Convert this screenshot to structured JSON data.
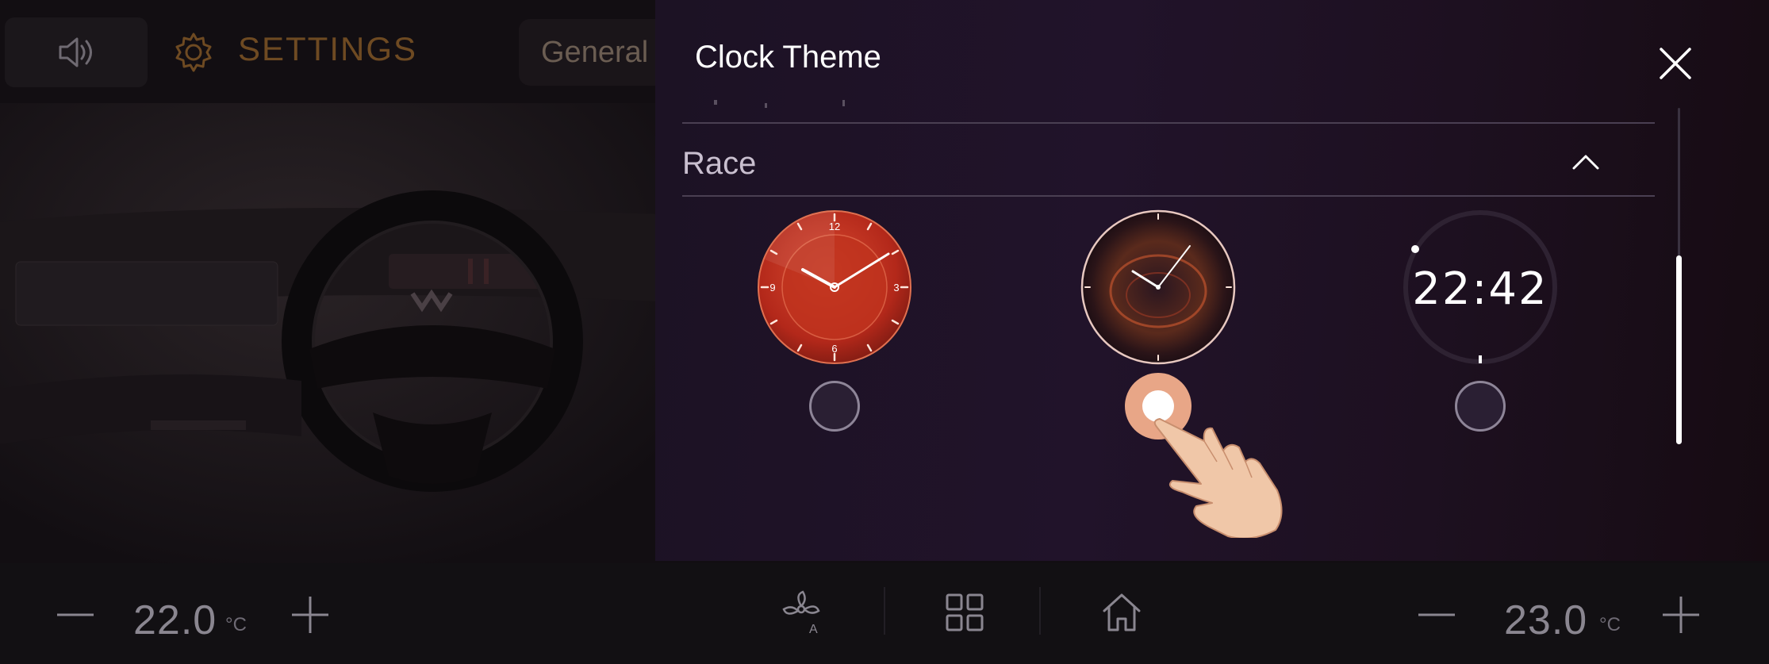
{
  "background": {
    "settings_title": "SETTINGS",
    "general_tab": "General"
  },
  "modal": {
    "title": "Clock Theme",
    "section_label": "Race",
    "options": [
      {
        "name": "analog-red",
        "selected": false
      },
      {
        "name": "analog-dark",
        "selected": true
      },
      {
        "name": "digital",
        "selected": false
      }
    ],
    "analog_numbers": [
      "12",
      "3",
      "6",
      "9"
    ],
    "digital_time": "22:42"
  },
  "climate": {
    "left_temp": "22.0",
    "right_temp": "23.0",
    "unit": "°C"
  },
  "icons": {
    "speaker": "speaker-icon",
    "settings": "gear-icon",
    "close": "close-icon",
    "collapse": "chevron-up-icon",
    "fan": "fan-auto-icon",
    "apps": "grid-icon",
    "home": "home-icon"
  },
  "colors": {
    "accent_orange": "#6e4a22",
    "red_clock": "#c2331f",
    "radio_selected": "#e8a687"
  }
}
